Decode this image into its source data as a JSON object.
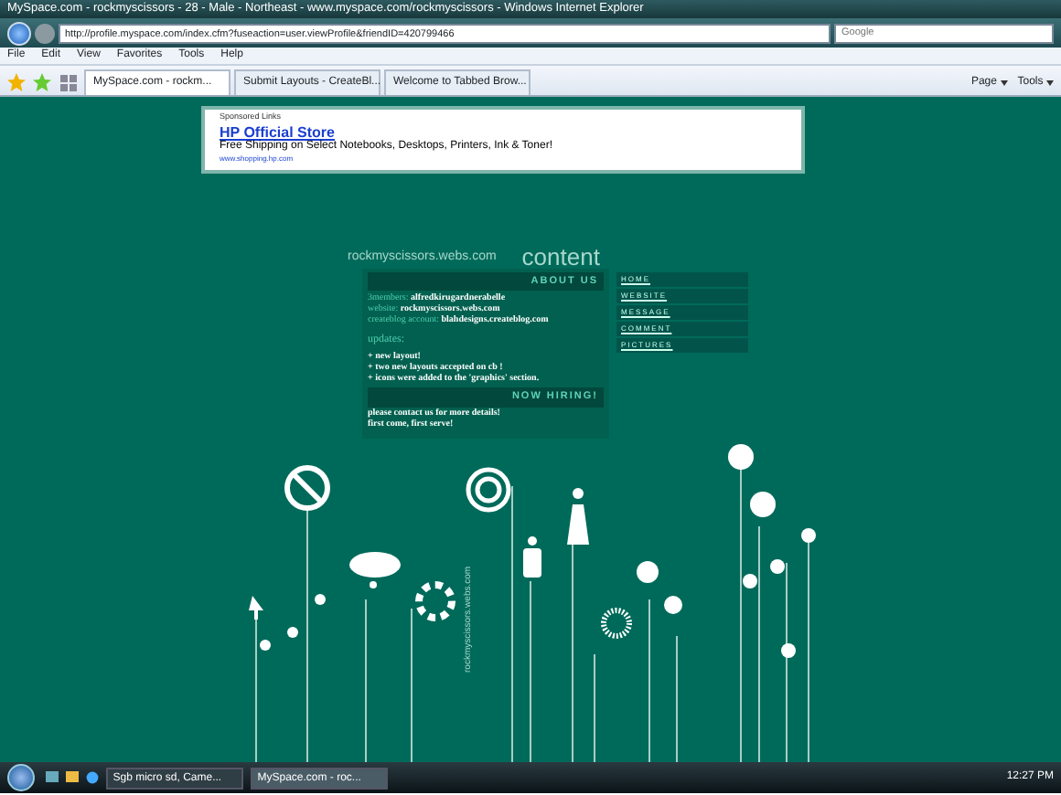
{
  "window": {
    "title": "MySpace.com - rockmyscissors - 28 - Male - Northeast - www.myspace.com/rockmyscissors - Windows Internet Explorer"
  },
  "address_bar": {
    "value": "http://profile.myspace.com/index.cfm?fuseaction=user.viewProfile&friendID=420799466",
    "search_placeholder": "Google"
  },
  "menu": [
    "File",
    "Edit",
    "View",
    "Favorites",
    "Tools",
    "Help"
  ],
  "tabs": [
    {
      "label": "MySpace.com - rockm...",
      "selected": true
    },
    {
      "label": "Submit Layouts - CreateBl...",
      "selected": false
    },
    {
      "label": "Welcome to Tabbed Brow...",
      "selected": false
    }
  ],
  "command_bar": [
    "Page",
    "Tools"
  ],
  "ad": {
    "header": "Sponsored Links",
    "title": "HP Official Store",
    "text": "Free Shipping on Select Notebooks, Desktops, Printers, Ink & Toner!",
    "url": "www.shopping.hp.com"
  },
  "profile": {
    "site_name": "rockmyscissors.webs.com",
    "heading": "content",
    "sections": [
      {
        "title": "ABOUT US",
        "lines": [
          {
            "label": "3members:",
            "value": "alfredkirugardnerabelle"
          },
          {
            "label": "website:",
            "value": "rockmyscissors.webs.com"
          },
          {
            "label": "createblog account:",
            "value": "blahdesigns.createblog.com"
          }
        ],
        "subheading": "updates:",
        "paragraphs": [
          "+ new layout!",
          "+ two new layouts accepted on cb !",
          "+ icons were added to the 'graphics' section."
        ]
      },
      {
        "title": "NOW HIRING!",
        "paragraphs": [
          "please contact us for more details!",
          "first come, first serve!"
        ]
      }
    ],
    "nav": [
      "HOME",
      "WEBSITE",
      "MESSAGE",
      "COMMENT",
      "PICTURES"
    ],
    "artwork_caption": "rockmyscissors.webs.com"
  },
  "taskbar": {
    "items": [
      {
        "label": "Sgb micro sd, Came...",
        "selected": false
      },
      {
        "label": "MySpace.com - roc...",
        "selected": true
      }
    ],
    "clock": "12:27 PM"
  }
}
